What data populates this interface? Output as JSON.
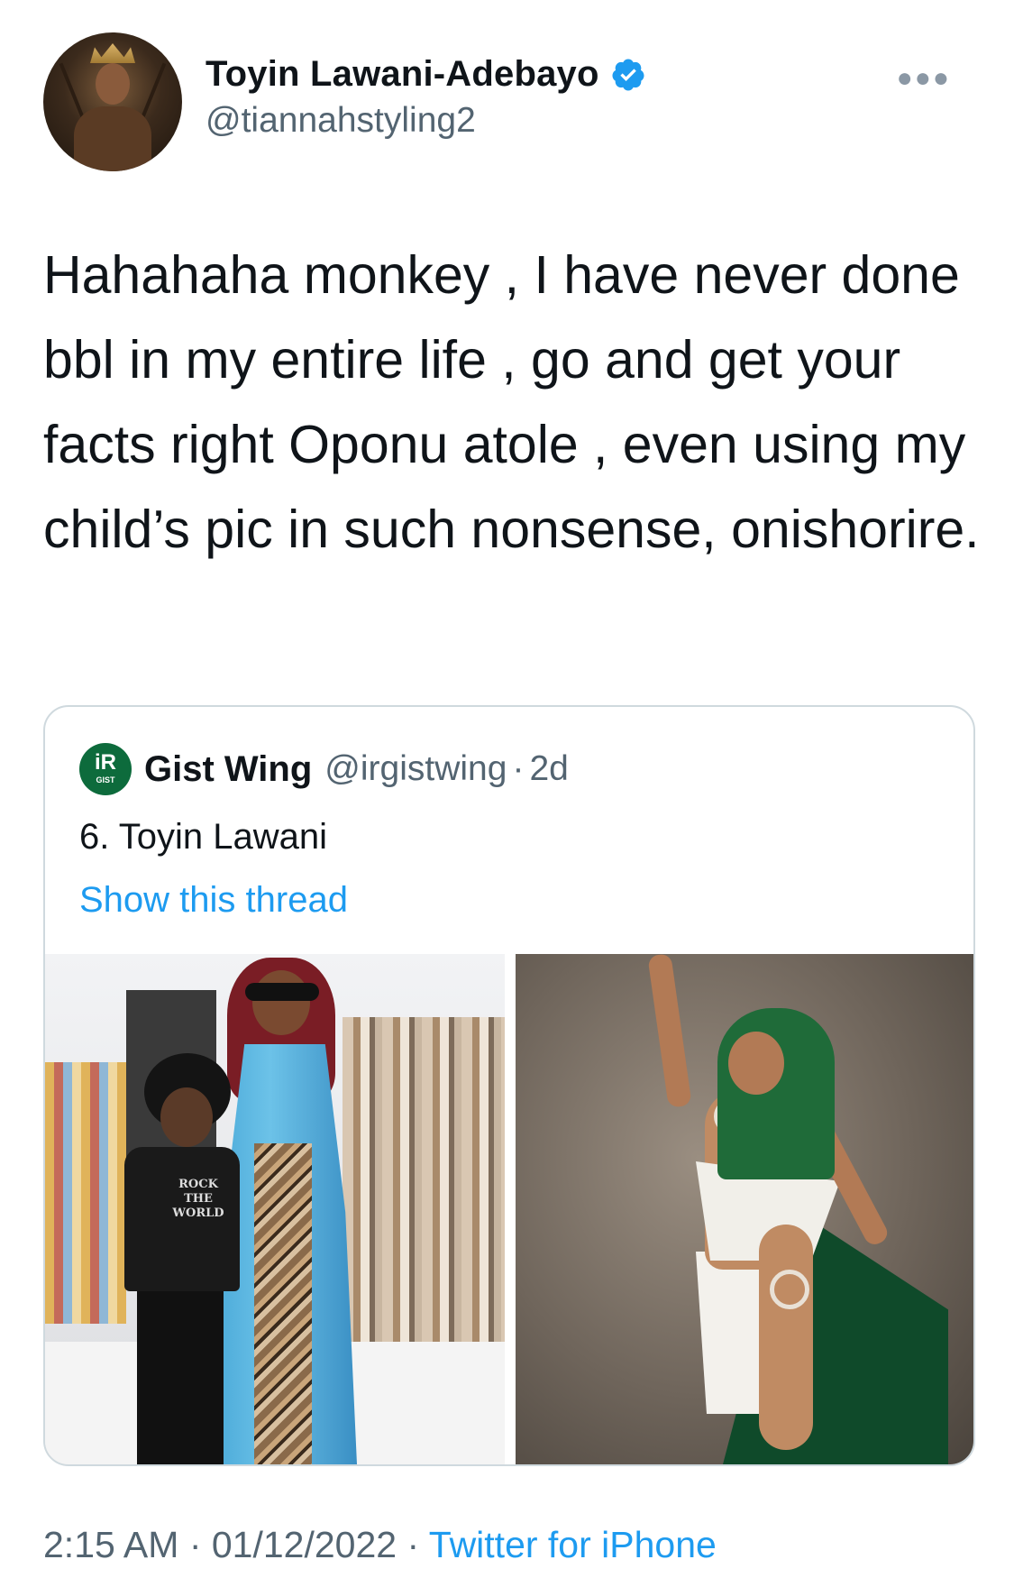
{
  "author": {
    "display_name": "Toyin Lawani-Adebayo",
    "handle": "@tiannahstyling2",
    "verified_icon": "verified-badge-icon",
    "avatar_icon": "profile-avatar"
  },
  "more_icon": "more-options-icon",
  "tweet": {
    "text": "Hahahaha monkey , I have never done bbl in my entire life , go and get your facts right Oponu atole , even using my child’s pic in such nonsense, onishorire."
  },
  "quoted_tweet": {
    "avatar_letters": "iR",
    "avatar_sub": "GIST",
    "display_name": "Gist Wing",
    "handle": "@irgistwing",
    "separator": "·",
    "time": "2d",
    "text": "6. Toyin Lawani",
    "show_thread": "Show this thread",
    "photo1_shirt_text": "ROCK THE WORLD"
  },
  "footer": {
    "time": "2:15 AM",
    "sep1": " · ",
    "date": "01/12/2022",
    "sep2": " · ",
    "source": "Twitter for iPhone"
  },
  "colors": {
    "link": "#1d9bf0",
    "secondary_text": "#536471",
    "border": "#cfd9de"
  }
}
